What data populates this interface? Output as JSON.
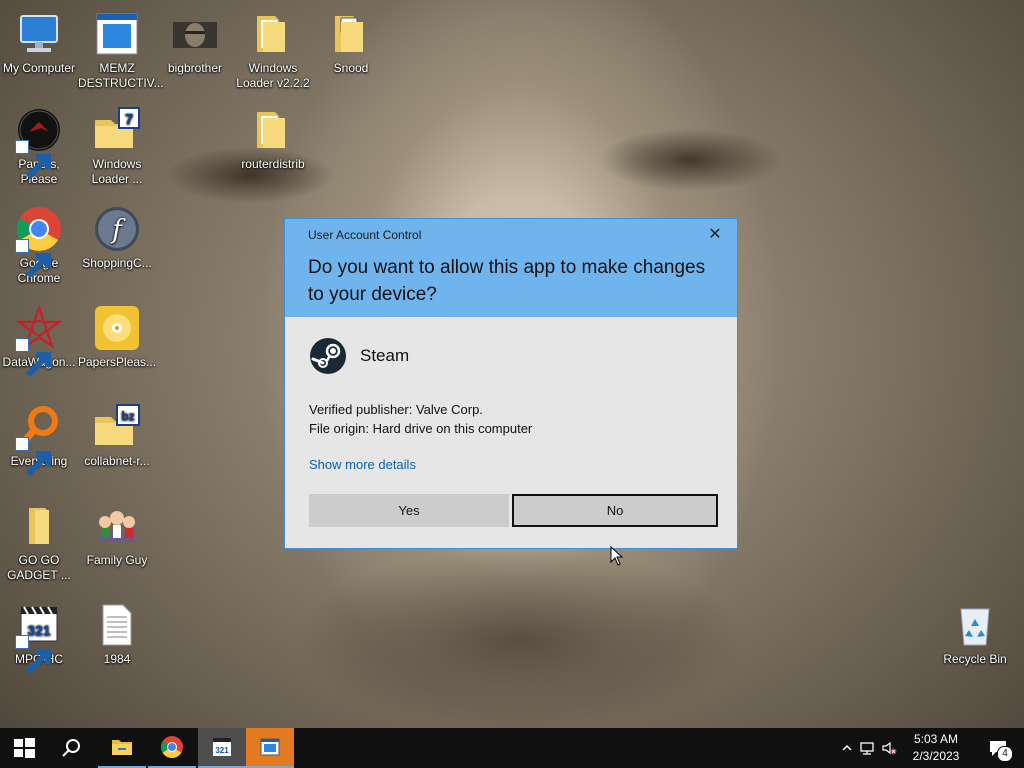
{
  "desktop": {
    "icons": [
      {
        "label": "My Computer",
        "icon": "computer-icon"
      },
      {
        "label": "MEMZ DESTRUCTIV...",
        "icon": "memz-icon"
      },
      {
        "label": "bigbrother",
        "icon": "photo-icon"
      },
      {
        "label": "Windows Loader v2.2.2",
        "icon": "folder-icon"
      },
      {
        "label": "Snood",
        "icon": "folder-icon"
      },
      {
        "label": "Papers, Please",
        "icon": "papers-please-icon"
      },
      {
        "label": "Windows Loader ...",
        "icon": "zip-folder-icon"
      },
      {
        "label": "routerdistrib",
        "icon": "folder-icon"
      },
      {
        "label": "Google Chrome",
        "icon": "chrome-icon"
      },
      {
        "label": "ShoppingC...",
        "icon": "flash-icon"
      },
      {
        "label": "DataWagon...",
        "icon": "datawagon-icon"
      },
      {
        "label": "PapersPleas...",
        "icon": "disc-icon"
      },
      {
        "label": "Everything",
        "icon": "search-icon"
      },
      {
        "label": "collabnet-r...",
        "icon": "bz-folder-icon"
      },
      {
        "label": "GO GO GADGET ...",
        "icon": "folder-icon"
      },
      {
        "label": "Family Guy",
        "icon": "family-guy-icon"
      },
      {
        "label": "MPC-HC",
        "icon": "mpc-hc-icon"
      },
      {
        "label": "1984",
        "icon": "text-file-icon"
      },
      {
        "label": "Recycle Bin",
        "icon": "recycle-bin-icon"
      }
    ]
  },
  "uac": {
    "caption": "User Account Control",
    "question": "Do you want to allow this app to make changes to your device?",
    "app_name": "Steam",
    "publisher": "Verified publisher: Valve Corp.",
    "origin": "File origin: Hard drive on this computer",
    "details_link": "Show more details",
    "yes_label": "Yes",
    "no_label": "No",
    "close_glyph": "✕"
  },
  "taskbar": {
    "items": [
      "start-icon",
      "search-icon",
      "file-explorer-icon",
      "chrome-icon",
      "mpc-hc-icon",
      "app-window-icon"
    ],
    "time": "5:03 AM",
    "date": "2/3/2023",
    "notification_count": "4"
  },
  "colors": {
    "uac_header": "#70b4ee",
    "uac_body": "#e6e6e6",
    "link": "#0a62b4",
    "taskbar": "#101010"
  }
}
